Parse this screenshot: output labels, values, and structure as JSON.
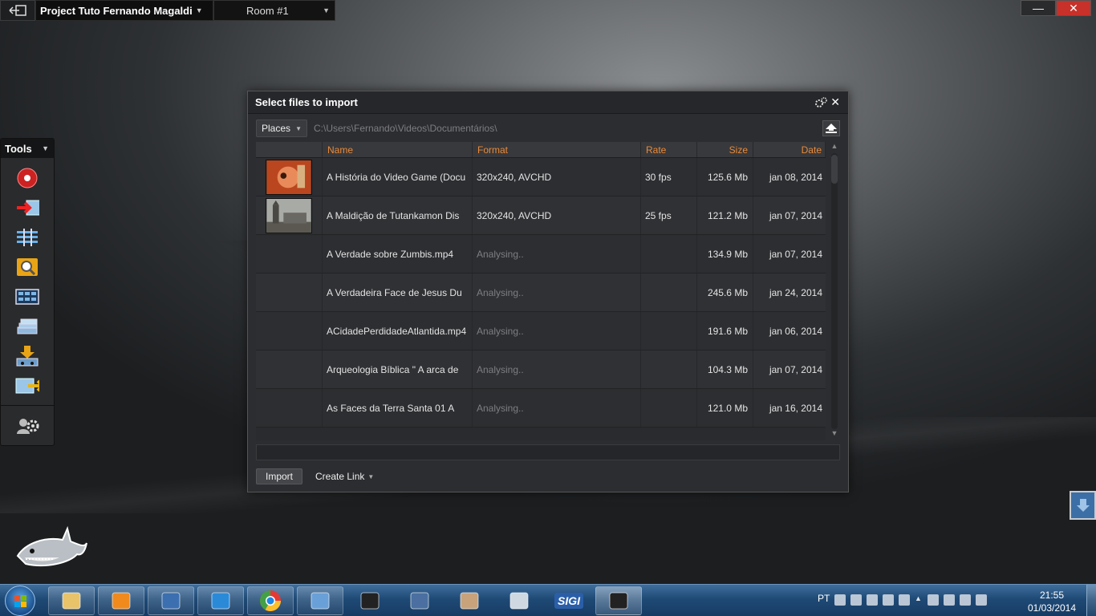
{
  "topbar": {
    "project": "Project Tuto Fernando Magaldi",
    "room": "Room #1",
    "minimize_icon": "minimize-icon",
    "close_icon": "close-icon"
  },
  "tools": {
    "title": "Tools",
    "items": [
      {
        "name": "record-icon"
      },
      {
        "name": "import-icon"
      },
      {
        "name": "timeline-icon"
      },
      {
        "name": "search-icon"
      },
      {
        "name": "grid-icon"
      },
      {
        "name": "layers-icon"
      },
      {
        "name": "download-icon"
      },
      {
        "name": "export-icon"
      },
      {
        "name": "settings-users-icon"
      }
    ]
  },
  "dialog": {
    "title": "Select files to import",
    "places_label": "Places",
    "path": "C:\\Users\\Fernando\\Videos\\Documentários\\",
    "columns": {
      "name": "Name",
      "format": "Format",
      "rate": "Rate",
      "size": "Size",
      "date": "Date"
    },
    "rows": [
      {
        "name": "A História do Video Game (Docu",
        "format": "320x240, AVCHD",
        "rate": "30 fps",
        "size": "125.6 Mb",
        "date": "jan 08, 2014",
        "thumb": "red"
      },
      {
        "name": "A Maldição de Tutankamon   Dis",
        "format": "320x240, AVCHD",
        "rate": "25 fps",
        "size": "121.2 Mb",
        "date": "jan 07, 2014",
        "thumb": "grey"
      },
      {
        "name": "A Verdade sobre Zumbis.mp4",
        "format": "Analysing..",
        "rate": "",
        "size": "134.9 Mb",
        "date": "jan 07, 2014",
        "thumb": ""
      },
      {
        "name": "A Verdadeira Face de Jesus   Du",
        "format": "Analysing..",
        "rate": "",
        "size": "245.6 Mb",
        "date": "jan 24, 2014",
        "thumb": ""
      },
      {
        "name": "ACidadePerdidadeAtlantida.mp4",
        "format": "Analysing..",
        "rate": "",
        "size": "191.6 Mb",
        "date": "jan 06, 2014",
        "thumb": ""
      },
      {
        "name": "Arqueologia Bíblica  \" A arca de",
        "format": "Analysing..",
        "rate": "",
        "size": "104.3 Mb",
        "date": "jan 07, 2014",
        "thumb": ""
      },
      {
        "name": "As Faces da Terra Santa   01   A",
        "format": "Analysing..",
        "rate": "",
        "size": "121.0 Mb",
        "date": "jan 16, 2014",
        "thumb": ""
      }
    ],
    "import_label": "Import",
    "create_link_label": "Create Link"
  },
  "taskbar": {
    "lang": "PT",
    "time": "21:55",
    "date": "01/03/2014",
    "apps": [
      "explorer-icon",
      "media-player-icon",
      "media-player-classic-icon",
      "internet-explorer-icon",
      "chrome-icon",
      "itunes-icon",
      "horse-app-icon",
      "pencil-app-icon",
      "photo-app-icon",
      "calculator-icon",
      "sigi-app-icon",
      "video-editor-icon"
    ],
    "sigi_label": "SIGI"
  }
}
